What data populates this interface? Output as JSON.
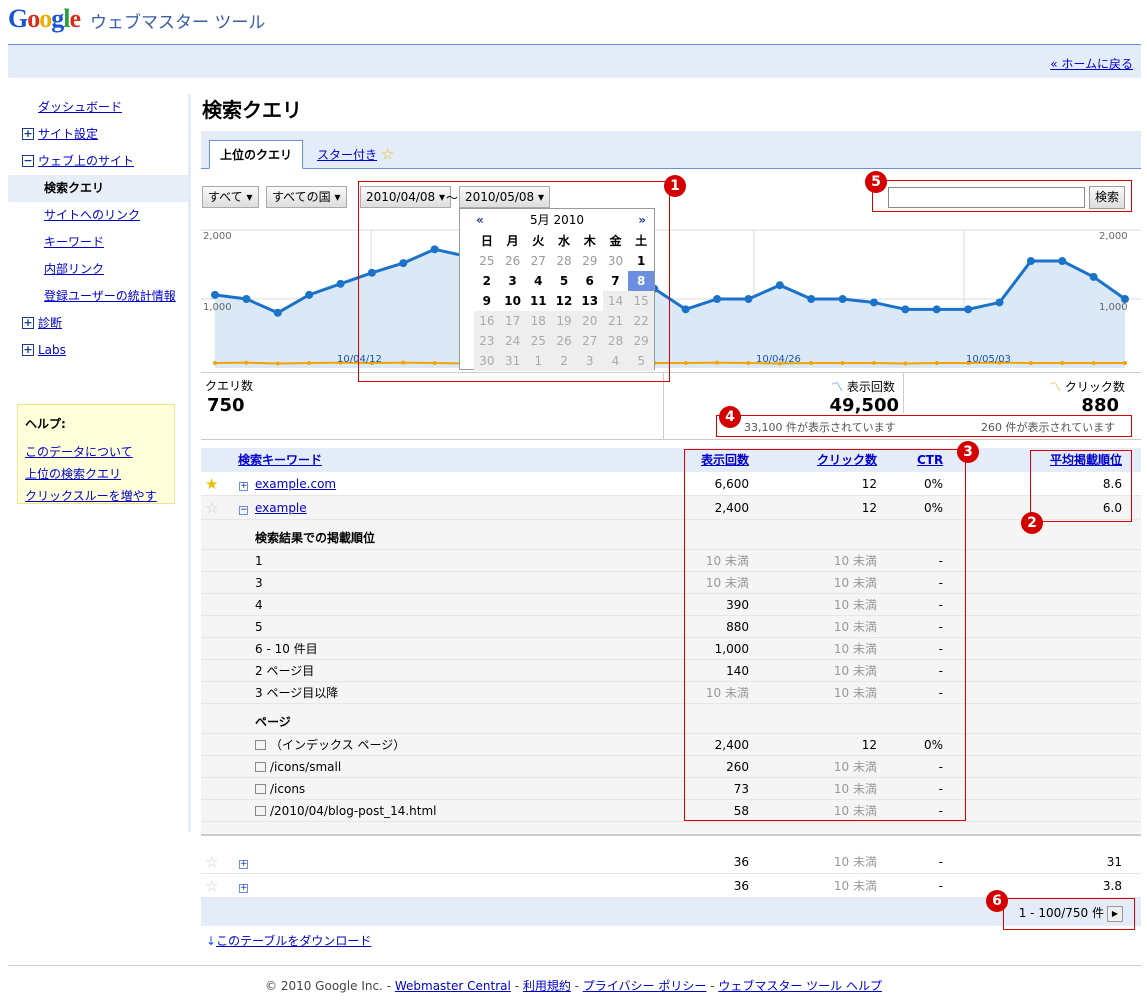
{
  "header": {
    "product": "ウェブマスター ツール",
    "home_link": "« ホームに戻る"
  },
  "sidebar": {
    "items": [
      {
        "label": "ダッシュボード",
        "type": "link"
      },
      {
        "label": "サイト設定",
        "type": "plus"
      },
      {
        "label": "ウェブ上のサイト",
        "type": "minus"
      },
      {
        "label": "検索クエリ",
        "type": "selected"
      },
      {
        "label": "サイトへのリンク",
        "type": "sub"
      },
      {
        "label": "キーワード",
        "type": "sub"
      },
      {
        "label": "内部リンク",
        "type": "sub"
      },
      {
        "label": "登録ユーザーの統計情報",
        "type": "sub"
      },
      {
        "label": "診断",
        "type": "plus"
      },
      {
        "label": "Labs",
        "type": "plus"
      }
    ]
  },
  "help": {
    "title": "ヘルプ:",
    "links": [
      "このデータについて",
      "上位の検索クエリ",
      "クリックスルーを増やす"
    ]
  },
  "page_title": "検索クエリ",
  "tabs": [
    "上位のクエリ",
    "スター付き"
  ],
  "filters": {
    "scope": "すべて",
    "country": "すべての国",
    "date_from": "2010/04/08",
    "date_sep": "～",
    "date_to": "2010/05/08"
  },
  "search": {
    "value": "",
    "button": "検索"
  },
  "calendar": {
    "month": "5月 2010",
    "prev": "«",
    "next": "»",
    "weekdays": [
      "日",
      "月",
      "火",
      "水",
      "木",
      "金",
      "土"
    ],
    "weeks": [
      [
        "25",
        "26",
        "27",
        "28",
        "29",
        "30",
        "1"
      ],
      [
        "2",
        "3",
        "4",
        "5",
        "6",
        "7",
        "8"
      ],
      [
        "9",
        "10",
        "11",
        "12",
        "13",
        "14",
        "15"
      ],
      [
        "16",
        "17",
        "18",
        "19",
        "20",
        "21",
        "22"
      ],
      [
        "23",
        "24",
        "25",
        "26",
        "27",
        "28",
        "29"
      ],
      [
        "30",
        "31",
        "1",
        "2",
        "3",
        "4",
        "5"
      ]
    ],
    "selected": "8"
  },
  "chart_data": {
    "type": "line",
    "ylim": [
      0,
      2000
    ],
    "y_ticks": [
      "2,000",
      "1,000"
    ],
    "x_labels": [
      "10/04/12",
      "10/04/26",
      "10/05/03"
    ],
    "series": [
      {
        "name": "表示回数",
        "color": "#1a73c8",
        "values": [
          1060,
          1000,
          800,
          1060,
          1220,
          1380,
          1520,
          1720,
          1620,
          1260,
          960,
          1060,
          1760,
          1520,
          1150,
          850,
          1000,
          1000,
          1200,
          1000,
          1000,
          950,
          850,
          850,
          850,
          950,
          1550,
          1550,
          1320,
          1000
        ]
      },
      {
        "name": "クリック数",
        "color": "#f4a400",
        "values": [
          12,
          13,
          11,
          12,
          13,
          12,
          13,
          12,
          11,
          12,
          13,
          12,
          12,
          11,
          12,
          12,
          13,
          12,
          11,
          12,
          12,
          12,
          11,
          12,
          12,
          13,
          12,
          12,
          12,
          12
        ]
      }
    ]
  },
  "stats": {
    "queries_label": "クエリ数",
    "queries": "750",
    "impressions_label": "表示回数",
    "impressions": "49,500",
    "impressions_sub": "33,100 件が表示されています",
    "clicks_label": "クリック数",
    "clicks": "880",
    "clicks_sub": "260 件が表示されています"
  },
  "table": {
    "headers": {
      "keyword": "検索キーワード",
      "impressions": "表示回数",
      "clicks": "クリック数",
      "ctr": "CTR",
      "position": "平均掲載順位"
    },
    "rows": [
      {
        "keyword": "example.com",
        "impressions": "6,600",
        "clicks": "12",
        "ctr": "0%",
        "position": "8.6",
        "starred": true
      },
      {
        "keyword": "example",
        "impressions": "2,400",
        "clicks": "12",
        "ctr": "0%",
        "position": "6.0",
        "starred": false
      }
    ],
    "rank_section": "検索結果での掲載順位",
    "rank_rows": [
      {
        "label": "1",
        "impressions": "10 未満",
        "clicks": "10 未満",
        "ctr": "-"
      },
      {
        "label": "3",
        "impressions": "10 未満",
        "clicks": "10 未満",
        "ctr": "-"
      },
      {
        "label": "4",
        "impressions": "390",
        "clicks": "10 未満",
        "ctr": "-"
      },
      {
        "label": "5",
        "impressions": "880",
        "clicks": "10 未満",
        "ctr": "-"
      },
      {
        "label": "6 - 10 件目",
        "impressions": "1,000",
        "clicks": "10 未満",
        "ctr": "-"
      },
      {
        "label": "2 ページ目",
        "impressions": "140",
        "clicks": "10 未満",
        "ctr": "-"
      },
      {
        "label": "3 ページ目以降",
        "impressions": "10 未満",
        "clicks": "10 未満",
        "ctr": "-"
      }
    ],
    "page_section": "ページ",
    "page_rows": [
      {
        "label": "（インデックス ページ）",
        "impressions": "2,400",
        "clicks": "12",
        "ctr": "0%"
      },
      {
        "label": "/icons/small",
        "impressions": "260",
        "clicks": "10 未満",
        "ctr": "-"
      },
      {
        "label": "/icons",
        "impressions": "73",
        "clicks": "10 未満",
        "ctr": "-"
      },
      {
        "label": "/2010/04/blog-post_14.html",
        "impressions": "58",
        "clicks": "10 未満",
        "ctr": "-"
      }
    ],
    "bottom_rows": [
      {
        "impressions": "36",
        "clicks": "10 未満",
        "ctr": "-",
        "position": "31"
      },
      {
        "impressions": "36",
        "clicks": "10 未満",
        "ctr": "-",
        "position": "3.8"
      }
    ]
  },
  "pager": {
    "text": "1 - 100/750 件"
  },
  "download": "このテーブルをダウンロード",
  "footer": {
    "copyright": "© 2010 Google Inc. -",
    "links": [
      "Webmaster Central",
      "利用規約",
      "プライバシー ポリシー",
      "ウェブマスター ツール ヘルプ"
    ]
  },
  "badges": [
    "1",
    "2",
    "3",
    "4",
    "5",
    "6"
  ]
}
